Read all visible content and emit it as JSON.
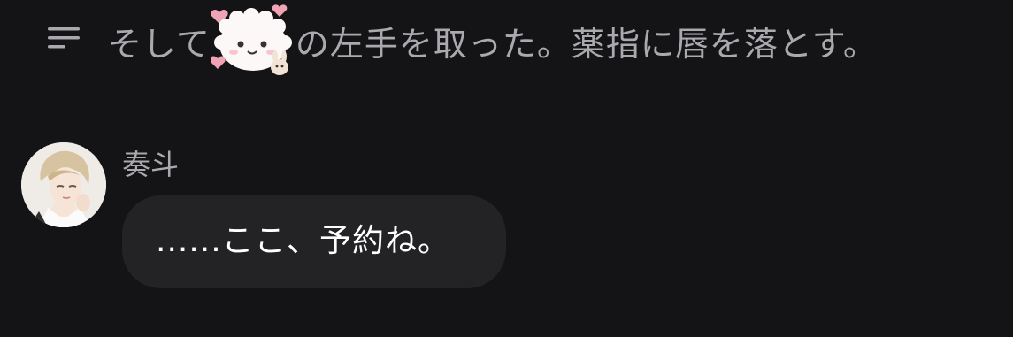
{
  "narration": {
    "text_before_sticker": "そして",
    "text_after_sticker": "の左手を取った。薬指に唇を落とす。",
    "sticker_icon": "fluffy-bunny-sticker"
  },
  "message": {
    "speaker": "奏斗",
    "text": "......ここ、予約ね。",
    "avatar_icon": "character-avatar"
  },
  "colors": {
    "background": "#141416",
    "bubble": "#232326",
    "muted_text": "#a9a9ae",
    "message_text": "#ffffff",
    "accent_heart": "#f0a3b4"
  }
}
